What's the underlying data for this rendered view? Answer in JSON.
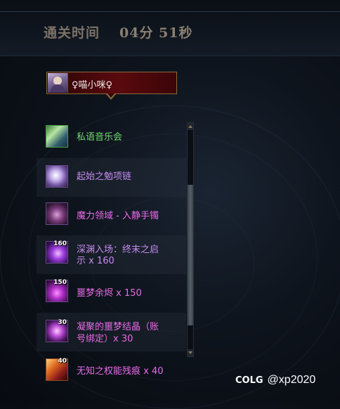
{
  "header": {
    "clear_time_label": "通关时间",
    "clear_time_value": "04分 51秒"
  },
  "player": {
    "name": "♀喵小咪♀"
  },
  "loot": [
    {
      "name": "私语音乐会",
      "qty": "",
      "icon": "music-box-icon",
      "color": "#6fdc6f"
    },
    {
      "name": "起始之勉项链",
      "qty": "",
      "icon": "necklace-icon",
      "color": "#c68cf2"
    },
    {
      "name": "魔力领域 - 入静手镯",
      "qty": "",
      "icon": "bracelet-icon",
      "color": "#e86be8"
    },
    {
      "name": "深渊入场：终末之启",
      "name2": "示 x 160",
      "qty": "160",
      "icon": "abyss-orb-icon",
      "color": "#c68cf2"
    },
    {
      "name": "噩梦余烬 x 150",
      "qty": "150",
      "icon": "ember-icon",
      "color": "#e86be8"
    },
    {
      "name": "凝聚的噩梦结晶（账",
      "name2": "号绑定）x 30",
      "qty": "30",
      "icon": "crystal-icon",
      "color": "#e86be8"
    },
    {
      "name": "无知之权能残痕 x 40",
      "qty": "40",
      "icon": "trace-icon",
      "color": "#e86be8"
    }
  ],
  "watermark": {
    "logo": "COLG",
    "handle": "@xp2020"
  }
}
